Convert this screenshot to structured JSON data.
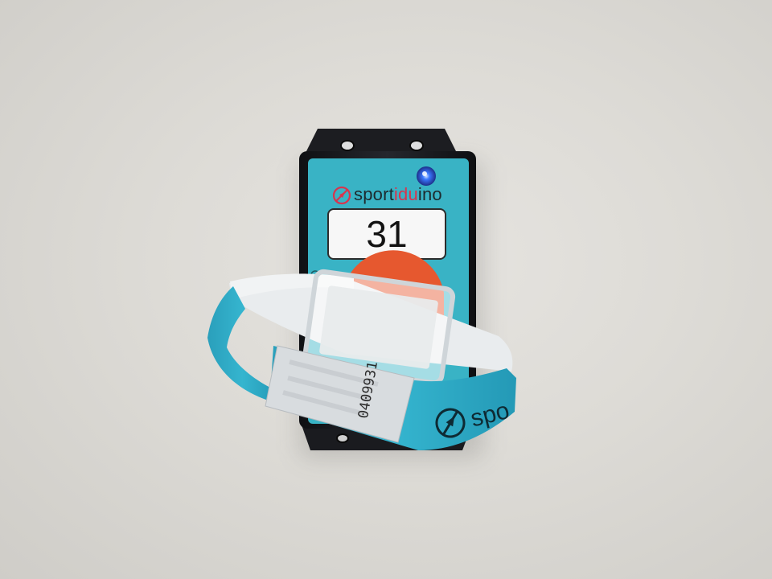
{
  "image": {
    "subject": "sportiduino",
    "colors": {
      "background": "#dcdad5",
      "device_body": "#17181c",
      "label_face": "#39b3c5",
      "button": "#e6582f",
      "wristband": "#2fa7c2",
      "led": "#2f6bff"
    }
  },
  "station": {
    "brand_prefix": "sport",
    "brand_accent": "idu",
    "brand_suffix": "ino",
    "number": "31"
  },
  "wristband": {
    "serial": "0409931",
    "brand": "spor"
  }
}
